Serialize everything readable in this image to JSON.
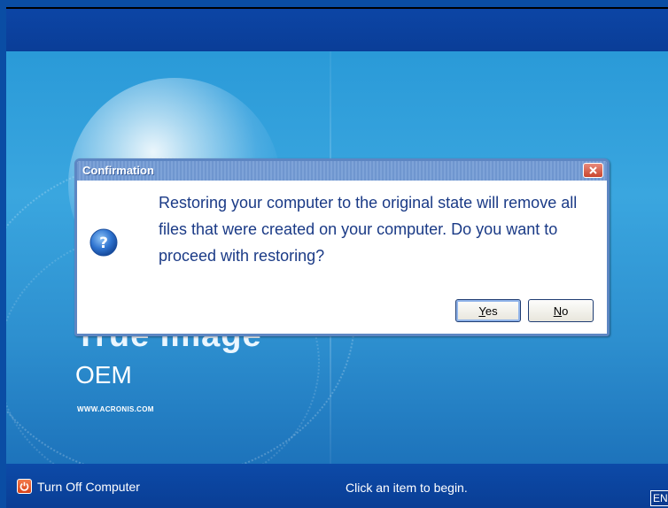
{
  "desktop": {
    "brand_big": "True Image",
    "brand_oem": "OEM",
    "brand_url": "WWW.ACRONIS.COM"
  },
  "taskbar": {
    "turn_off_label": "Turn Off Computer",
    "status": "Click an item to begin.",
    "language": "EN"
  },
  "dialog": {
    "title": "Confirmation",
    "message": "Restoring your computer to the original state will remove all files that were created on your computer. Do you want to proceed with restoring?",
    "buttons": {
      "yes": {
        "accel": "Y",
        "rest": "es"
      },
      "no": {
        "accel": "N",
        "rest": "o"
      }
    },
    "icon": "question-icon"
  },
  "colors": {
    "desktop_blue": "#2a9ad8",
    "taskbar_blue": "#0a4da4",
    "dialog_border": "#5d86c3",
    "message_text": "#1a3a86",
    "close_red": "#c9452e"
  }
}
